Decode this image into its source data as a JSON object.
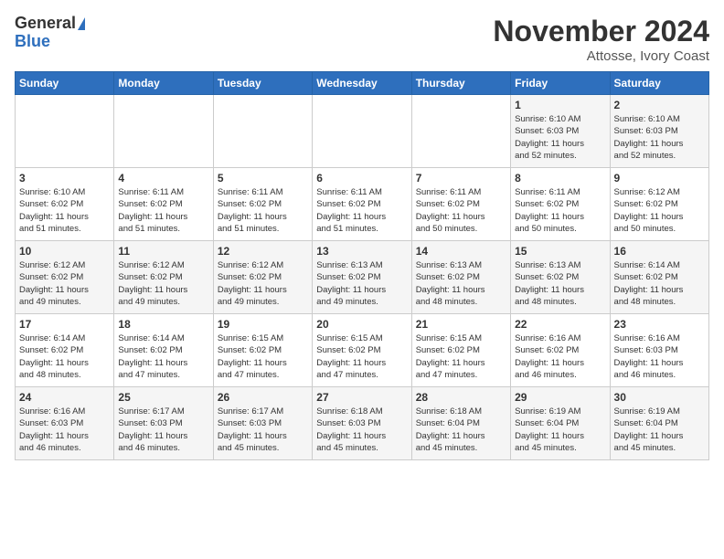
{
  "header": {
    "logo_general": "General",
    "logo_blue": "Blue",
    "month_title": "November 2024",
    "location": "Attosse, Ivory Coast"
  },
  "weekdays": [
    "Sunday",
    "Monday",
    "Tuesday",
    "Wednesday",
    "Thursday",
    "Friday",
    "Saturday"
  ],
  "weeks": [
    [
      {
        "day": "",
        "info": ""
      },
      {
        "day": "",
        "info": ""
      },
      {
        "day": "",
        "info": ""
      },
      {
        "day": "",
        "info": ""
      },
      {
        "day": "",
        "info": ""
      },
      {
        "day": "1",
        "info": "Sunrise: 6:10 AM\nSunset: 6:03 PM\nDaylight: 11 hours\nand 52 minutes."
      },
      {
        "day": "2",
        "info": "Sunrise: 6:10 AM\nSunset: 6:03 PM\nDaylight: 11 hours\nand 52 minutes."
      }
    ],
    [
      {
        "day": "3",
        "info": "Sunrise: 6:10 AM\nSunset: 6:02 PM\nDaylight: 11 hours\nand 51 minutes."
      },
      {
        "day": "4",
        "info": "Sunrise: 6:11 AM\nSunset: 6:02 PM\nDaylight: 11 hours\nand 51 minutes."
      },
      {
        "day": "5",
        "info": "Sunrise: 6:11 AM\nSunset: 6:02 PM\nDaylight: 11 hours\nand 51 minutes."
      },
      {
        "day": "6",
        "info": "Sunrise: 6:11 AM\nSunset: 6:02 PM\nDaylight: 11 hours\nand 51 minutes."
      },
      {
        "day": "7",
        "info": "Sunrise: 6:11 AM\nSunset: 6:02 PM\nDaylight: 11 hours\nand 50 minutes."
      },
      {
        "day": "8",
        "info": "Sunrise: 6:11 AM\nSunset: 6:02 PM\nDaylight: 11 hours\nand 50 minutes."
      },
      {
        "day": "9",
        "info": "Sunrise: 6:12 AM\nSunset: 6:02 PM\nDaylight: 11 hours\nand 50 minutes."
      }
    ],
    [
      {
        "day": "10",
        "info": "Sunrise: 6:12 AM\nSunset: 6:02 PM\nDaylight: 11 hours\nand 49 minutes."
      },
      {
        "day": "11",
        "info": "Sunrise: 6:12 AM\nSunset: 6:02 PM\nDaylight: 11 hours\nand 49 minutes."
      },
      {
        "day": "12",
        "info": "Sunrise: 6:12 AM\nSunset: 6:02 PM\nDaylight: 11 hours\nand 49 minutes."
      },
      {
        "day": "13",
        "info": "Sunrise: 6:13 AM\nSunset: 6:02 PM\nDaylight: 11 hours\nand 49 minutes."
      },
      {
        "day": "14",
        "info": "Sunrise: 6:13 AM\nSunset: 6:02 PM\nDaylight: 11 hours\nand 48 minutes."
      },
      {
        "day": "15",
        "info": "Sunrise: 6:13 AM\nSunset: 6:02 PM\nDaylight: 11 hours\nand 48 minutes."
      },
      {
        "day": "16",
        "info": "Sunrise: 6:14 AM\nSunset: 6:02 PM\nDaylight: 11 hours\nand 48 minutes."
      }
    ],
    [
      {
        "day": "17",
        "info": "Sunrise: 6:14 AM\nSunset: 6:02 PM\nDaylight: 11 hours\nand 48 minutes."
      },
      {
        "day": "18",
        "info": "Sunrise: 6:14 AM\nSunset: 6:02 PM\nDaylight: 11 hours\nand 47 minutes."
      },
      {
        "day": "19",
        "info": "Sunrise: 6:15 AM\nSunset: 6:02 PM\nDaylight: 11 hours\nand 47 minutes."
      },
      {
        "day": "20",
        "info": "Sunrise: 6:15 AM\nSunset: 6:02 PM\nDaylight: 11 hours\nand 47 minutes."
      },
      {
        "day": "21",
        "info": "Sunrise: 6:15 AM\nSunset: 6:02 PM\nDaylight: 11 hours\nand 47 minutes."
      },
      {
        "day": "22",
        "info": "Sunrise: 6:16 AM\nSunset: 6:02 PM\nDaylight: 11 hours\nand 46 minutes."
      },
      {
        "day": "23",
        "info": "Sunrise: 6:16 AM\nSunset: 6:03 PM\nDaylight: 11 hours\nand 46 minutes."
      }
    ],
    [
      {
        "day": "24",
        "info": "Sunrise: 6:16 AM\nSunset: 6:03 PM\nDaylight: 11 hours\nand 46 minutes."
      },
      {
        "day": "25",
        "info": "Sunrise: 6:17 AM\nSunset: 6:03 PM\nDaylight: 11 hours\nand 46 minutes."
      },
      {
        "day": "26",
        "info": "Sunrise: 6:17 AM\nSunset: 6:03 PM\nDaylight: 11 hours\nand 45 minutes."
      },
      {
        "day": "27",
        "info": "Sunrise: 6:18 AM\nSunset: 6:03 PM\nDaylight: 11 hours\nand 45 minutes."
      },
      {
        "day": "28",
        "info": "Sunrise: 6:18 AM\nSunset: 6:04 PM\nDaylight: 11 hours\nand 45 minutes."
      },
      {
        "day": "29",
        "info": "Sunrise: 6:19 AM\nSunset: 6:04 PM\nDaylight: 11 hours\nand 45 minutes."
      },
      {
        "day": "30",
        "info": "Sunrise: 6:19 AM\nSunset: 6:04 PM\nDaylight: 11 hours\nand 45 minutes."
      }
    ]
  ]
}
